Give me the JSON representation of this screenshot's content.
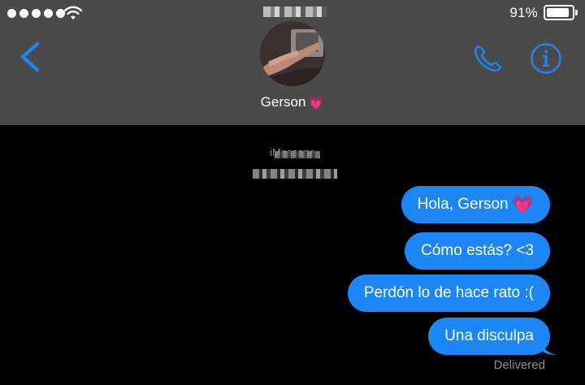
{
  "status_bar": {
    "signal_bars": 5,
    "battery_percent_label": "91%",
    "battery_level": 0.91
  },
  "header": {
    "contact_name": "Gerson",
    "contact_emoji": "💗",
    "icons": {
      "back": "chevron-left-icon",
      "phone": "phone-icon",
      "info": "info-icon",
      "wifi": "wifi-icon"
    },
    "accent_color": "#1d86f5",
    "background_color": "#4a4a4a"
  },
  "conversation": {
    "service_label": "iMessage",
    "messages": [
      {
        "text": "Hola, Gerson",
        "emoji": "💗",
        "sender": "me"
      },
      {
        "text": "Cómo estás? <3",
        "sender": "me"
      },
      {
        "text": "Perdón lo de hace rato :(",
        "sender": "me"
      },
      {
        "text": "Una disculpa",
        "sender": "me"
      }
    ],
    "delivery_status": "Delivered",
    "bubble_color": "#1d86f5"
  }
}
